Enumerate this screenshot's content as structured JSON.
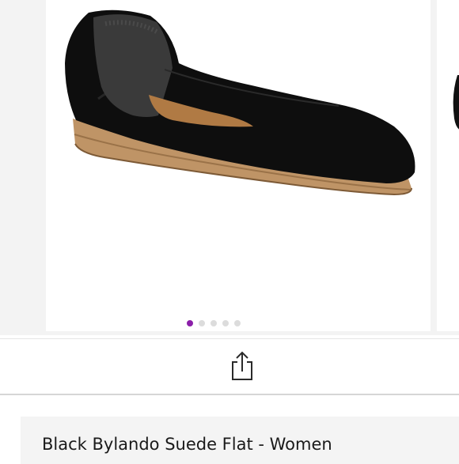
{
  "carousel": {
    "image_alt": "Black suede pointed-toe ballet flat",
    "page_count": 5,
    "active_index": 0
  },
  "actions": {
    "share_icon": "share-icon"
  },
  "product": {
    "title": "Black Bylando Suede Flat - Women"
  },
  "colors": {
    "accent": "#8b1fa9",
    "inactive_dot": "#dcdcdc",
    "background": "#f3f3f3"
  }
}
